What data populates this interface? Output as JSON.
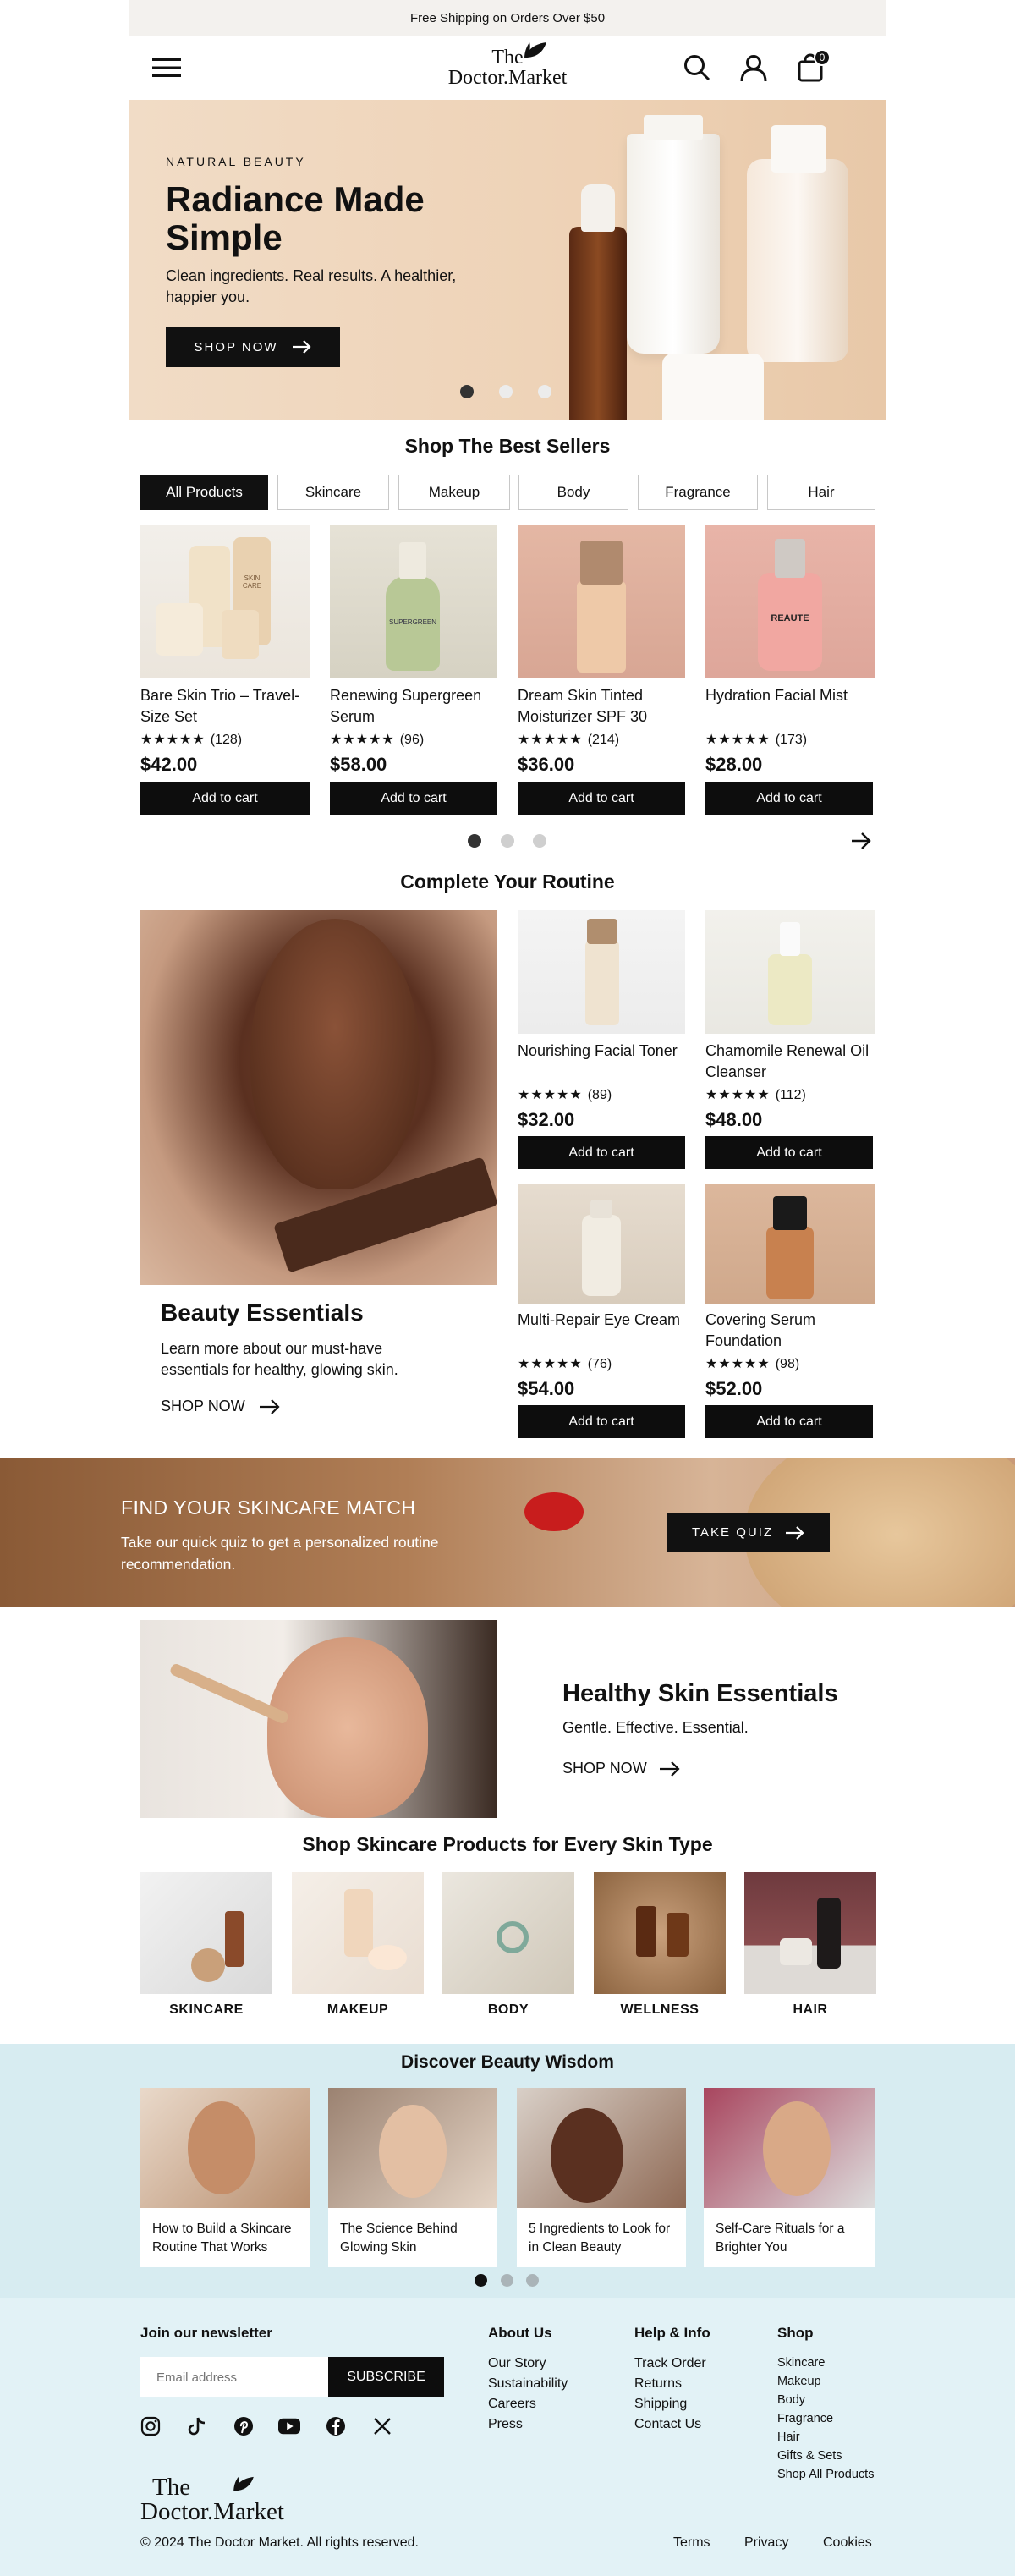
{
  "announcement": "Free Shipping on Orders Over $50",
  "brand": {
    "line1": "The",
    "line2": "Doctor.Market"
  },
  "header": {
    "cart_count": "0"
  },
  "hero": {
    "kicker": "NATURAL BEAUTY",
    "title": "Radiance Made Simple",
    "subtitle": "Clean ingredients. Real results. A healthier, happier you.",
    "cta": "SHOP NOW"
  },
  "best_sellers": {
    "title": "Shop The Best Sellers",
    "tabs": [
      "All Products",
      "Skincare",
      "Makeup",
      "Body",
      "Fragrance",
      "Hair"
    ],
    "products": [
      {
        "name": "Bare Skin Trio – Travel-Size Set",
        "stars": "★★★★★",
        "reviews": "(128)",
        "price": "$42.00",
        "cta": "Add to cart"
      },
      {
        "name": "Renewing Supergreen Serum",
        "stars": "★★★★★",
        "reviews": "(96)",
        "price": "$58.00",
        "cta": "Add to cart"
      },
      {
        "name": "Dream Skin Tinted Moisturizer SPF 30",
        "stars": "★★★★★",
        "reviews": "(214)",
        "price": "$36.00",
        "cta": "Add to cart"
      },
      {
        "name": "Hydration Facial Mist",
        "stars": "★★★★★",
        "reviews": "(173)",
        "price": "$28.00",
        "cta": "Add to cart"
      }
    ],
    "product_labels": [
      "SKIN CARE",
      "SUPERGREEN",
      "",
      "REAUTE"
    ]
  },
  "routine": {
    "title": "Complete Your Routine",
    "feature_title": "Beauty Essentials",
    "feature_text": "Learn more about our must-have essentials for healthy, glowing skin.",
    "feature_cta": "SHOP NOW",
    "products": [
      {
        "name": "Nourishing Facial Toner",
        "stars": "★★★★★",
        "reviews": "(89)",
        "price": "$32.00",
        "cta": "Add to cart"
      },
      {
        "name": "Chamomile Renewal Oil Cleanser",
        "stars": "★★★★★",
        "reviews": "(112)",
        "price": "$48.00",
        "cta": "Add to cart"
      },
      {
        "name": "Multi-Repair Eye Cream",
        "stars": "★★★★★",
        "reviews": "(76)",
        "price": "$54.00",
        "cta": "Add to cart"
      },
      {
        "name": "Covering Serum Foundation",
        "stars": "★★★★★",
        "reviews": "(98)",
        "price": "$52.00",
        "cta": "Add to cart"
      }
    ]
  },
  "quiz": {
    "title": "FIND YOUR SKINCARE MATCH",
    "text": "Take our quick quiz to get a personalized routine recommendation.",
    "cta": "TAKE QUIZ"
  },
  "healthy": {
    "title": "Healthy Skin Essentials",
    "subtitle": "Gentle. Effective. Essential.",
    "cta": "SHOP NOW"
  },
  "skin_types": {
    "title": "Shop Skincare Products for Every Skin Type",
    "categories": [
      "SKINCARE",
      "MAKEUP",
      "BODY",
      "WELLNESS",
      "HAIR"
    ]
  },
  "wisdom": {
    "title": "Discover Beauty Wisdom",
    "articles": [
      "How to Build a Skincare Routine That Works",
      "The Science Behind Glowing Skin",
      "5 Ingredients to Look for in Clean Beauty",
      "Self-Care Rituals for a Brighter You"
    ]
  },
  "footer": {
    "newsletter_title": "Join our newsletter",
    "email_placeholder": "Email address",
    "subscribe": "SUBSCRIBE",
    "social": [
      "instagram-icon",
      "tiktok-icon",
      "pinterest-icon",
      "youtube-icon",
      "facebook-icon",
      "x-icon"
    ],
    "columns": [
      {
        "title": "About Us",
        "links": [
          "Our Story",
          "Sustainability",
          "Careers",
          "Press"
        ]
      },
      {
        "title": "Help & Info",
        "links": [
          "Track Order",
          "Returns",
          "Shipping",
          "Contact Us"
        ]
      },
      {
        "title": "Shop",
        "links": [
          "Skincare",
          "Makeup",
          "Body",
          "Fragrance",
          "Hair",
          "Gifts & Sets",
          "Shop All Products"
        ]
      }
    ],
    "copyright": "© 2024 The Doctor Market. All rights reserved.",
    "legal": [
      "Terms",
      "Privacy",
      "Cookies"
    ]
  },
  "colors": {
    "accent": "#111111",
    "hero_bg": "#f1dcc6",
    "wisdom_bg": "#d7ecf1",
    "footer_bg": "#e2f2f6"
  }
}
